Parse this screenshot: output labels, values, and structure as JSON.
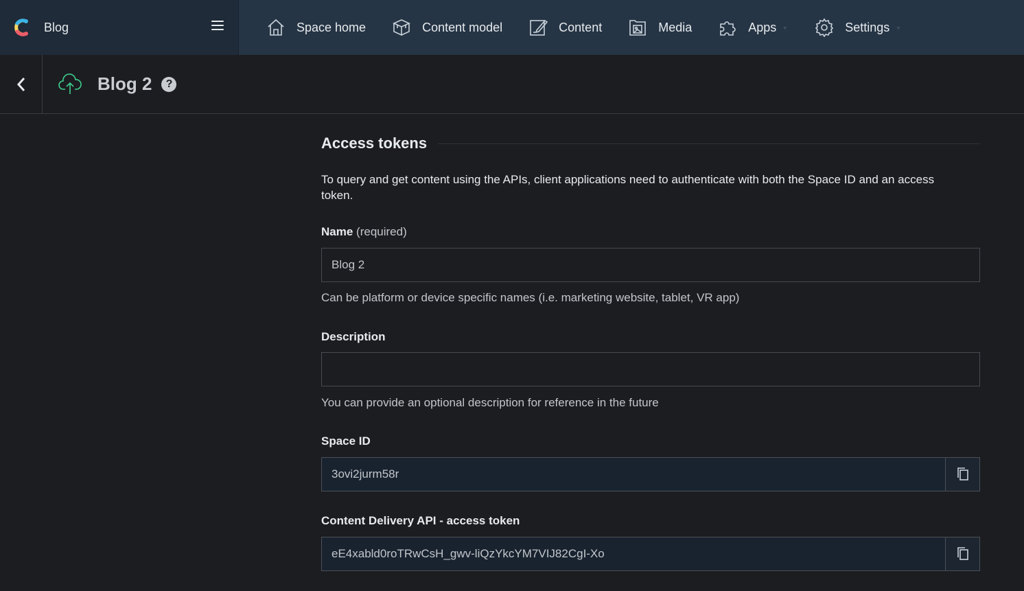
{
  "space": {
    "name": "Blog"
  },
  "nav": {
    "items": [
      {
        "label": "Space home",
        "icon": "home-icon"
      },
      {
        "label": "Content model",
        "icon": "content-model-icon"
      },
      {
        "label": "Content",
        "icon": "content-edit-icon"
      },
      {
        "label": "Media",
        "icon": "media-icon"
      },
      {
        "label": "Apps",
        "icon": "puzzle-icon"
      },
      {
        "label": "Settings",
        "icon": "gear-icon"
      }
    ]
  },
  "header": {
    "title": "Blog 2",
    "help": "?"
  },
  "section": {
    "title": "Access tokens",
    "intro": "To query and get content using the APIs, client applications need to authenticate with both the Space ID and an access token."
  },
  "form": {
    "name": {
      "label": "Name",
      "required": "(required)",
      "value": "Blog 2",
      "hint": "Can be platform or device specific names (i.e. marketing website, tablet, VR app)"
    },
    "description": {
      "label": "Description",
      "value": "",
      "hint": "You can provide an optional description for reference in the future"
    },
    "space_id": {
      "label": "Space ID",
      "value": "3ovi2jurm58r"
    },
    "cda_token": {
      "label": "Content Delivery API - access token",
      "value": "eE4xabld0roTRwCsH_gwv-liQzYkcYM7VIJ82CgI-Xo"
    }
  },
  "colors": {
    "topbar": "#263545",
    "space_switch": "#1f2b38",
    "background": "#1c1d21",
    "accent_green": "#3ecf8e"
  }
}
